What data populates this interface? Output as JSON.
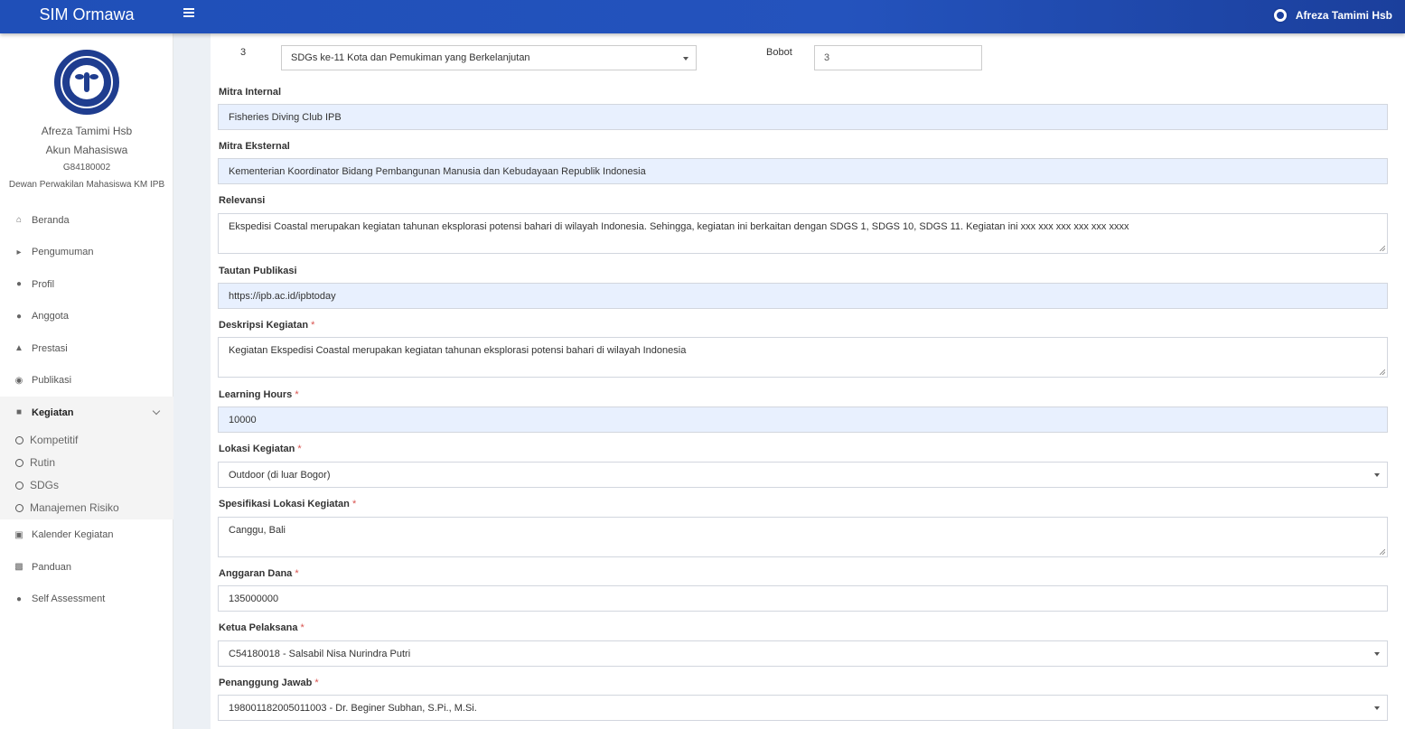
{
  "app": {
    "title": "SIM Ormawa",
    "menu_toggle_icon": "hamburger-icon"
  },
  "topbar": {
    "user_name": "Afreza Tamimi Hsb",
    "user_logo_icon": "university-seal-icon"
  },
  "profile": {
    "name": "Afreza Tamimi Hsb",
    "role": "Akun Mahasiswa",
    "nim": "G84180002",
    "organization": "Dewan Perwakilan Mahasiswa KM IPB"
  },
  "sidebar": {
    "items": [
      {
        "label": "Beranda",
        "icon": "home-icon"
      },
      {
        "label": "Pengumuman",
        "icon": "bullhorn-icon"
      },
      {
        "label": "Profil",
        "icon": "user-icon"
      },
      {
        "label": "Anggota",
        "icon": "users-icon"
      },
      {
        "label": "Prestasi",
        "icon": "trophy-icon"
      },
      {
        "label": "Publikasi",
        "icon": "comments-icon"
      },
      {
        "label": "Kegiatan",
        "icon": "folder-icon",
        "active": true
      },
      {
        "label": "Kalender Kegiatan",
        "icon": "calendar-icon"
      },
      {
        "label": "Panduan",
        "icon": "book-icon"
      },
      {
        "label": "Self Assessment",
        "icon": "user-icon"
      }
    ],
    "submenu": [
      "Kompetitif",
      "Rutin",
      "SDGs",
      "Manajemen Risiko"
    ]
  },
  "form": {
    "sdg_row": {
      "number": "3",
      "sdg_value": "SDGs ke-11 Kota dan Pemukiman yang Berkelanjutan",
      "bobot_label": "Bobot",
      "bobot_value": "3"
    },
    "mitra_internal": {
      "label": "Mitra Internal",
      "value": "Fisheries Diving Club IPB"
    },
    "mitra_eksternal": {
      "label": "Mitra Eksternal",
      "value": "Kementerian Koordinator Bidang Pembangunan Manusia dan Kebudayaan Republik Indonesia"
    },
    "relevansi": {
      "label": "Relevansi",
      "value": "Ekspedisi Coastal merupakan kegiatan tahunan eksplorasi potensi bahari di wilayah Indonesia. Sehingga, kegiatan ini berkaitan dengan SDGS 1, SDGS 10, SDGS 11. Kegiatan ini xxx xxx xxx xxx xxx xxxx"
    },
    "tautan_publikasi": {
      "label": "Tautan Publikasi",
      "value": "https://ipb.ac.id/ipbtoday"
    },
    "deskripsi": {
      "label": "Deskripsi Kegiatan",
      "value": "Kegiatan Ekspedisi Coastal merupakan kegiatan tahunan eksplorasi potensi bahari di wilayah Indonesia"
    },
    "learning_hours": {
      "label": "Learning Hours",
      "value": "10000"
    },
    "lokasi": {
      "label": "Lokasi Kegiatan",
      "value": "Outdoor (di luar Bogor)"
    },
    "spesifikasi_lokasi": {
      "label": "Spesifikasi Lokasi Kegiatan",
      "value": "Canggu, Bali"
    },
    "anggaran": {
      "label": "Anggaran Dana",
      "value": "135000000"
    },
    "ketua": {
      "label": "Ketua Pelaksana",
      "value": "C54180018 - Salsabil Nisa Nurindra Putri"
    },
    "penanggung_jawab": {
      "label": "Penanggung Jawab",
      "value": "198001182005011003 - Dr. Beginer Subhan, S.Pi., M.Si."
    },
    "required_mark": "*"
  },
  "colors": {
    "topbar": "#2453bd",
    "required": "#d9534f",
    "autofill_bg": "#e8f0fe"
  }
}
